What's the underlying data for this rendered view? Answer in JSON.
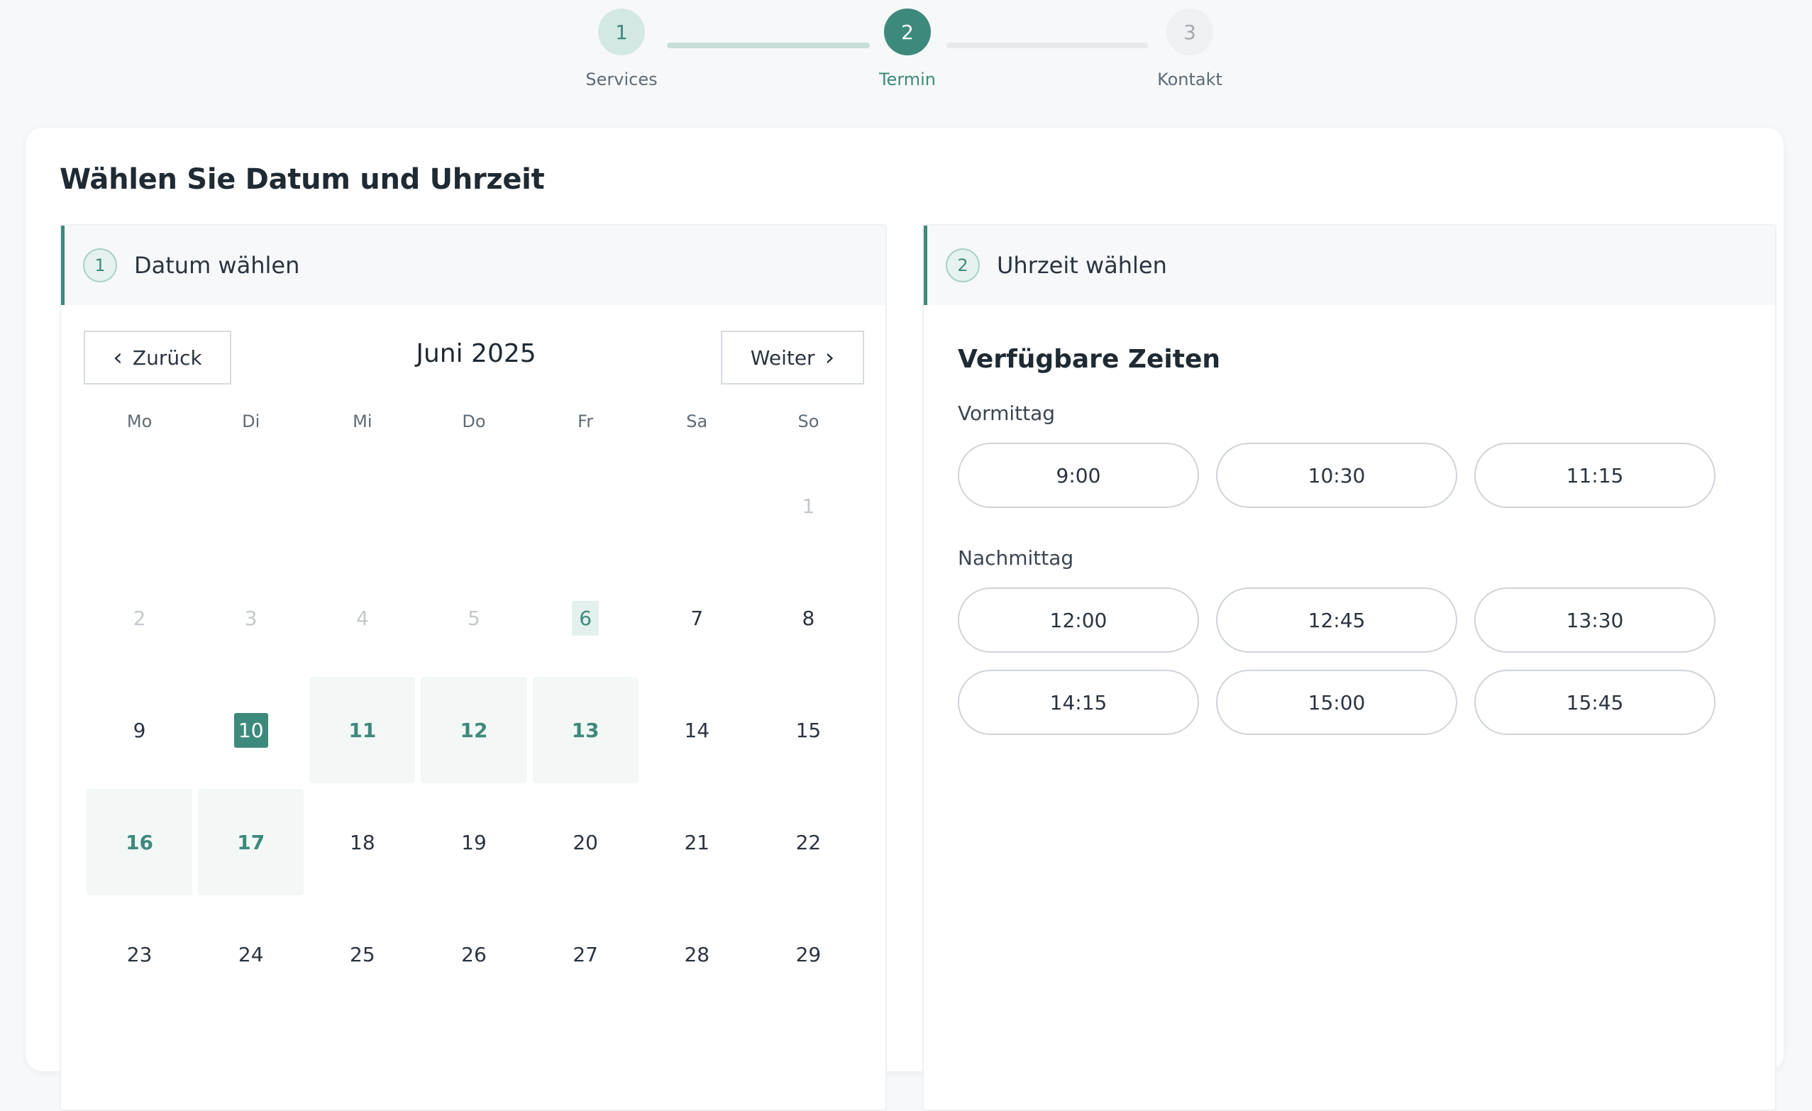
{
  "stepper": {
    "steps": [
      {
        "number": "1",
        "label": "Services",
        "state": "done"
      },
      {
        "number": "2",
        "label": "Termin",
        "state": "active"
      },
      {
        "number": "3",
        "label": "Kontakt",
        "state": "todo"
      }
    ]
  },
  "page": {
    "title": "Wählen Sie Datum und Uhrzeit"
  },
  "date_panel": {
    "badge": "1",
    "title": "Datum wählen",
    "prev_label": "Zurück",
    "next_label": "Weiter",
    "month": "Juni 2025",
    "weekdays": [
      "Mo",
      "Di",
      "Mi",
      "Do",
      "Fr",
      "Sa",
      "So"
    ],
    "days": [
      {
        "label": "",
        "state": "empty"
      },
      {
        "label": "",
        "state": "empty"
      },
      {
        "label": "",
        "state": "empty"
      },
      {
        "label": "",
        "state": "empty"
      },
      {
        "label": "",
        "state": "empty"
      },
      {
        "label": "",
        "state": "empty"
      },
      {
        "label": "1",
        "state": "muted"
      },
      {
        "label": "2",
        "state": "muted"
      },
      {
        "label": "3",
        "state": "muted"
      },
      {
        "label": "4",
        "state": "muted"
      },
      {
        "label": "5",
        "state": "muted"
      },
      {
        "label": "6",
        "state": "today"
      },
      {
        "label": "7",
        "state": "normal"
      },
      {
        "label": "8",
        "state": "normal"
      },
      {
        "label": "9",
        "state": "normal"
      },
      {
        "label": "10",
        "state": "selected"
      },
      {
        "label": "11",
        "state": "avail"
      },
      {
        "label": "12",
        "state": "avail"
      },
      {
        "label": "13",
        "state": "avail"
      },
      {
        "label": "14",
        "state": "normal"
      },
      {
        "label": "15",
        "state": "normal"
      },
      {
        "label": "16",
        "state": "avail"
      },
      {
        "label": "17",
        "state": "avail"
      },
      {
        "label": "18",
        "state": "normal"
      },
      {
        "label": "19",
        "state": "normal"
      },
      {
        "label": "20",
        "state": "normal"
      },
      {
        "label": "21",
        "state": "normal"
      },
      {
        "label": "22",
        "state": "normal"
      },
      {
        "label": "23",
        "state": "normal"
      },
      {
        "label": "24",
        "state": "normal"
      },
      {
        "label": "25",
        "state": "normal"
      },
      {
        "label": "26",
        "state": "normal"
      },
      {
        "label": "27",
        "state": "normal"
      },
      {
        "label": "28",
        "state": "normal"
      },
      {
        "label": "29",
        "state": "normal"
      }
    ]
  },
  "time_panel": {
    "badge": "2",
    "title": "Uhrzeit wählen",
    "available_title": "Verfügbare Zeiten",
    "morning_label": "Vormittag",
    "morning_slots": [
      "9:00",
      "10:30",
      "11:15"
    ],
    "afternoon_label": "Nachmittag",
    "afternoon_slots": [
      "12:00",
      "12:45",
      "13:30",
      "14:15",
      "15:00",
      "15:45"
    ]
  },
  "colors": {
    "accent": "#3d8a7c",
    "accent_light": "#d4e8e3",
    "background": "#f7f8f9",
    "text": "#2a3440"
  }
}
